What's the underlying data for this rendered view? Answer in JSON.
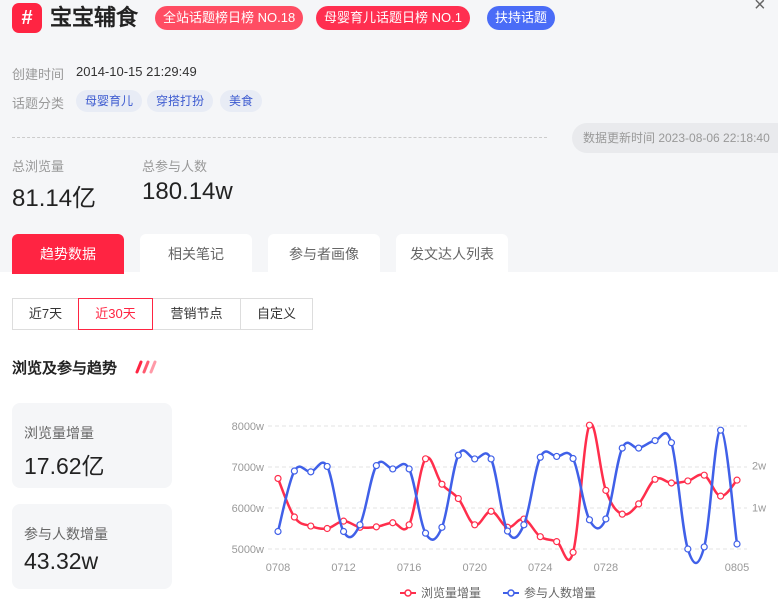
{
  "header": {
    "hash_symbol": "#",
    "title": "宝宝辅食",
    "tags": [
      "全站话题榜日榜 NO.18",
      "母婴育儿话题日榜 NO.1",
      "扶持话题"
    ],
    "close_symbol": "×"
  },
  "meta": {
    "created_label": "创建时间",
    "created_value": "2014-10-15 21:29:49",
    "category_label": "话题分类",
    "categories": [
      "母婴育儿",
      "穿搭打扮",
      "美食"
    ],
    "update_text": "数据更新时间 2023-08-06 22:18:40"
  },
  "stats": [
    {
      "label": "总浏览量",
      "value": "81.14亿"
    },
    {
      "label": "总参与人数",
      "value": "180.14w"
    }
  ],
  "tabs": [
    "趋势数据",
    "相关笔记",
    "参与者画像",
    "发文达人列表"
  ],
  "active_tab": 0,
  "ranges": [
    "近7天",
    "近30天",
    "营销节点",
    "自定义"
  ],
  "active_range": 1,
  "section_title": "浏览及参与趋势",
  "cards": [
    {
      "label": "浏览量增量",
      "value": "17.62亿"
    },
    {
      "label": "参与人数增量",
      "value": "43.32w"
    }
  ],
  "colors": {
    "accent": "#ff2442",
    "views": "#ff2e4c",
    "participants": "#4060e8"
  },
  "chart_data": {
    "type": "line",
    "x": [
      "0708",
      "0709",
      "0710",
      "0711",
      "0712",
      "0713",
      "0714",
      "0715",
      "0716",
      "0717",
      "0718",
      "0719",
      "0720",
      "0721",
      "0722",
      "0723",
      "0724",
      "0725",
      "0726",
      "0727",
      "0728",
      "0729",
      "0730",
      "0731",
      "0801",
      "0802",
      "0803",
      "0804",
      "0805"
    ],
    "x_tick_labels": [
      "0708",
      "0712",
      "0716",
      "0720",
      "0724",
      "0728",
      "0805"
    ],
    "y_left_ticks": [
      "5000w",
      "6000w",
      "7000w",
      "8000w"
    ],
    "y_left_range": [
      5000,
      8000
    ],
    "y_right_ticks": [
      "1w",
      "2w"
    ],
    "y_right_range": [
      0,
      2.95
    ],
    "grid": true,
    "legend_position": "bottom",
    "series": [
      {
        "name": "浏览量增量",
        "axis": "left",
        "values": [
          6720,
          5780,
          5560,
          5500,
          5680,
          5530,
          5540,
          5640,
          5590,
          7200,
          6580,
          6230,
          5590,
          5920,
          5530,
          5730,
          5300,
          5180,
          4920,
          8020,
          6430,
          5850,
          6100,
          6700,
          6610,
          6660,
          6800,
          6290,
          6680
        ]
      },
      {
        "name": "参与人数增量",
        "axis": "right",
        "values": [
          0.42,
          1.87,
          1.85,
          1.98,
          0.42,
          0.58,
          2.0,
          1.92,
          1.92,
          0.38,
          0.52,
          2.25,
          2.16,
          2.16,
          0.43,
          0.58,
          2.2,
          2.22,
          2.17,
          0.7,
          0.72,
          2.42,
          2.42,
          2.6,
          2.55,
          0.0,
          0.05,
          2.85,
          0.12
        ]
      }
    ]
  }
}
